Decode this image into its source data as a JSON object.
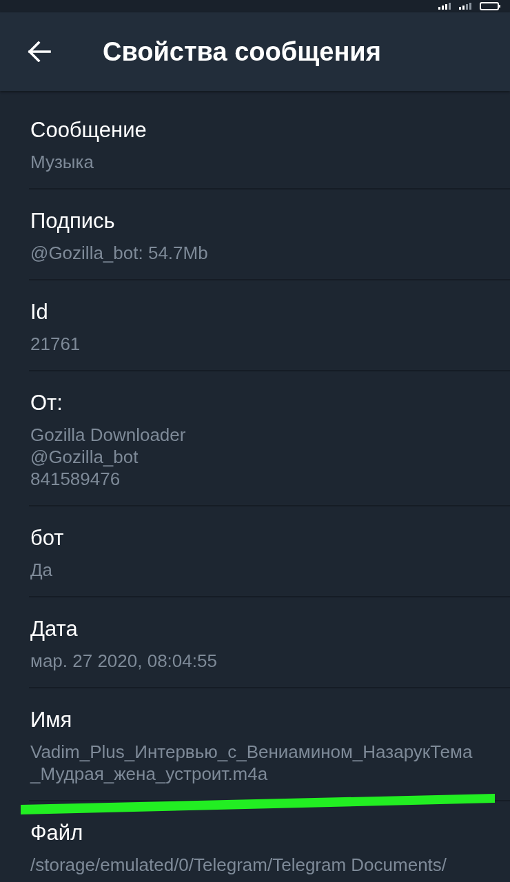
{
  "header": {
    "title": "Свойства сообщения"
  },
  "properties": [
    {
      "label": "Сообщение",
      "lines": [
        "Музыка"
      ]
    },
    {
      "label": "Подпись",
      "lines": [
        "@Gozilla_bot: 54.7Mb"
      ]
    },
    {
      "label": "Id",
      "lines": [
        "21761"
      ]
    },
    {
      "label": "От:",
      "lines": [
        "Gozilla Downloader",
        "@Gozilla_bot",
        "841589476"
      ]
    },
    {
      "label": "бот",
      "lines": [
        "Да"
      ]
    },
    {
      "label": "Дата",
      "lines": [
        "мар. 27 2020, 08:04:55"
      ]
    },
    {
      "label": "Имя",
      "lines": [
        "Vadim_Plus_Интервью_с_Вениамином_НазарукТема_Мудрая_жена_устроит.m4a"
      ]
    },
    {
      "label": "Файл",
      "lines": [
        "/storage/emulated/0/Telegram/Telegram Documents/"
      ]
    }
  ],
  "annotation": {
    "kind": "stroke"
  }
}
